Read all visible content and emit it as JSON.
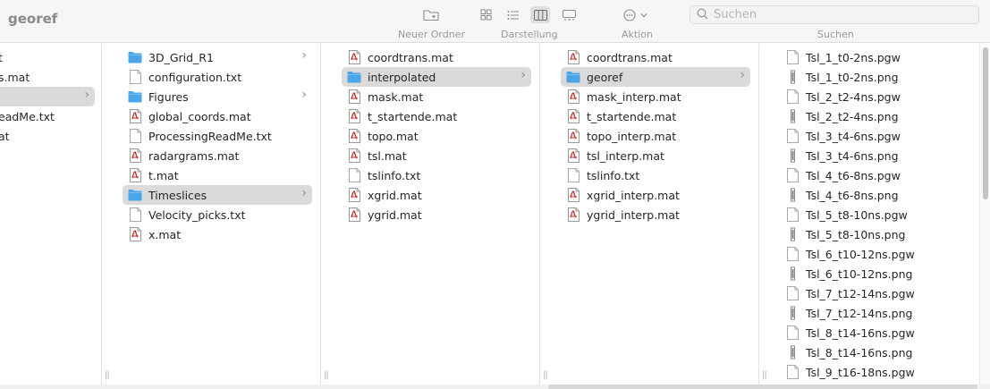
{
  "window": {
    "title": "georef"
  },
  "toolbar": {
    "new_folder": {
      "label": "Neuer Ordner",
      "icon": "folder-plus-icon"
    },
    "view": {
      "label": "Darstellung",
      "modes": [
        "icon-view-icon",
        "list-view-icon",
        "column-view-icon",
        "gallery-view-icon"
      ],
      "active": "column-view-icon"
    },
    "action": {
      "label": "Aktion",
      "icon": "ellipsis-circle-icon"
    },
    "search": {
      "label": "Suchen",
      "placeholder": "Suchen",
      "value": ""
    }
  },
  "columns": [
    {
      "id": "col0",
      "items": [
        {
          "name": "t",
          "type": "file"
        },
        {
          "name": "s.mat",
          "type": "mat"
        },
        {
          "name": "",
          "type": "folder",
          "selected": true,
          "chevron": true
        },
        {
          "name": "eadMe.txt",
          "type": "txt"
        },
        {
          "name": "at",
          "type": "mat"
        }
      ]
    },
    {
      "id": "col1",
      "items": [
        {
          "name": "3D_Grid_R1",
          "type": "folder",
          "chevron": true
        },
        {
          "name": "configuration.txt",
          "type": "txt"
        },
        {
          "name": "Figures",
          "type": "folder",
          "chevron": true
        },
        {
          "name": "global_coords.mat",
          "type": "mat"
        },
        {
          "name": "ProcessingReadMe.txt",
          "type": "txt"
        },
        {
          "name": "radargrams.mat",
          "type": "mat"
        },
        {
          "name": "t.mat",
          "type": "mat"
        },
        {
          "name": "Timeslices",
          "type": "folder",
          "chevron": true,
          "selected": true
        },
        {
          "name": "Velocity_picks.txt",
          "type": "txt"
        },
        {
          "name": "x.mat",
          "type": "mat"
        }
      ]
    },
    {
      "id": "col2",
      "items": [
        {
          "name": "coordtrans.mat",
          "type": "mat"
        },
        {
          "name": "interpolated",
          "type": "folder",
          "chevron": true,
          "selected": true
        },
        {
          "name": "mask.mat",
          "type": "mat"
        },
        {
          "name": "t_startende.mat",
          "type": "mat"
        },
        {
          "name": "topo.mat",
          "type": "mat"
        },
        {
          "name": "tsl.mat",
          "type": "mat"
        },
        {
          "name": "tslinfo.txt",
          "type": "txt"
        },
        {
          "name": "xgrid.mat",
          "type": "mat"
        },
        {
          "name": "ygrid.mat",
          "type": "mat"
        }
      ]
    },
    {
      "id": "col3",
      "items": [
        {
          "name": "coordtrans.mat",
          "type": "mat"
        },
        {
          "name": "georef",
          "type": "folder",
          "chevron": true,
          "selected": true
        },
        {
          "name": "mask_interp.mat",
          "type": "mat"
        },
        {
          "name": "t_startende.mat",
          "type": "mat"
        },
        {
          "name": "topo_interp.mat",
          "type": "mat"
        },
        {
          "name": "tsl_interp.mat",
          "type": "mat"
        },
        {
          "name": "tslinfo.txt",
          "type": "txt"
        },
        {
          "name": "xgrid_interp.mat",
          "type": "mat"
        },
        {
          "name": "ygrid_interp.mat",
          "type": "mat"
        }
      ]
    },
    {
      "id": "col4",
      "items": [
        {
          "name": "Tsl_1_t0-2ns.pgw",
          "type": "pgw"
        },
        {
          "name": "Tsl_1_t0-2ns.png",
          "type": "png"
        },
        {
          "name": "Tsl_2_t2-4ns.pgw",
          "type": "pgw"
        },
        {
          "name": "Tsl_2_t2-4ns.png",
          "type": "png"
        },
        {
          "name": "Tsl_3_t4-6ns.pgw",
          "type": "pgw"
        },
        {
          "name": "Tsl_3_t4-6ns.png",
          "type": "png"
        },
        {
          "name": "Tsl_4_t6-8ns.pgw",
          "type": "pgw"
        },
        {
          "name": "Tsl_4_t6-8ns.png",
          "type": "png"
        },
        {
          "name": "Tsl_5_t8-10ns.pgw",
          "type": "pgw"
        },
        {
          "name": "Tsl_5_t8-10ns.png",
          "type": "png"
        },
        {
          "name": "Tsl_6_t10-12ns.pgw",
          "type": "pgw"
        },
        {
          "name": "Tsl_6_t10-12ns.png",
          "type": "png"
        },
        {
          "name": "Tsl_7_t12-14ns.pgw",
          "type": "pgw"
        },
        {
          "name": "Tsl_7_t12-14ns.png",
          "type": "png"
        },
        {
          "name": "Tsl_8_t14-16ns.pgw",
          "type": "pgw"
        },
        {
          "name": "Tsl_8_t14-16ns.png",
          "type": "png"
        },
        {
          "name": "Tsl_9_t16-18ns.pgw",
          "type": "pgw"
        }
      ]
    }
  ],
  "colors": {
    "folder": "#4aa6e8",
    "selection": "#dadada",
    "pdf_red": "#c9302c"
  }
}
